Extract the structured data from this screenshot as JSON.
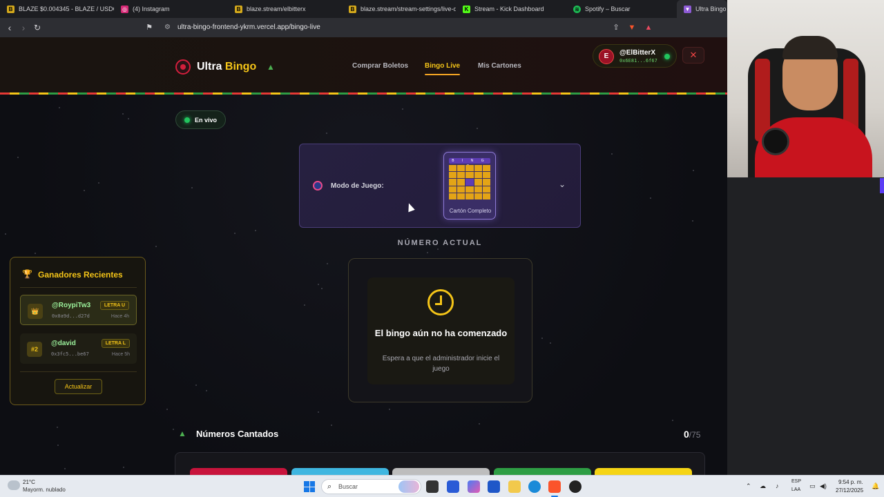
{
  "browser": {
    "tabs": [
      {
        "title": "BLAZE $0.004345 - BLAZE / USDC on",
        "icon": "blaze-icon",
        "color": "#d4a91c"
      },
      {
        "title": "(4) Instagram",
        "icon": "instagram-icon",
        "color": "#d62976"
      },
      {
        "title": "blaze.stream/elbitterx",
        "icon": "blaze-icon",
        "color": "#d4a91c"
      },
      {
        "title": "blaze.stream/stream-settings/live-da",
        "icon": "blaze-icon",
        "color": "#d4a91c"
      },
      {
        "title": "Stream - Kick Dashboard",
        "icon": "kick-icon",
        "color": "#53fc18"
      },
      {
        "title": "Spotify – Buscar",
        "icon": "spotify-icon",
        "color": "#1db954"
      },
      {
        "title": "Ultra Bingo - U",
        "icon": "ultra-bingo-icon",
        "color": "#8e5bd6"
      }
    ],
    "url": "ultra-bingo-frontend-ykrm.vercel.app/bingo-live"
  },
  "header": {
    "logo_part1": "Ultra",
    "logo_part2": "Bingo",
    "nav": [
      "Comprar Boletos",
      "Bingo Live",
      "Mis Cartones"
    ],
    "active_nav": "Bingo Live",
    "user": {
      "initial": "E",
      "name": "@ElBitterX",
      "address": "0x6E81...6f67"
    },
    "logout_symbol": "✕"
  },
  "status": {
    "label": "En vivo"
  },
  "mode": {
    "label": "Modo de Juego:",
    "card_header": "B I N G O",
    "card_label": "Cartón Completo"
  },
  "current_number": {
    "section_label": "NÚMERO ACTUAL",
    "title": "El bingo aún no ha comenzado",
    "subtitle": "Espera a que el administrador inicie el juego"
  },
  "winners": {
    "title": "Ganadores Recientes",
    "items": [
      {
        "badge": "👑",
        "name": "@RoypiTw3",
        "address": "0x0a9d...d27d",
        "tag": "LETRA U",
        "time": "Hace 4h"
      },
      {
        "badge": "#2",
        "name": "@david",
        "address": "0x3fc5...be67",
        "tag": "LETRA L",
        "time": "Hace 5h"
      }
    ],
    "refresh_label": "Actualizar"
  },
  "called_numbers": {
    "title": "Números Cantados",
    "count": "0",
    "total": "/75",
    "column_colors": [
      "#c8143c",
      "#3fb6e0",
      "#bdbdbd",
      "#2e9d44",
      "#f5d415"
    ]
  },
  "taskbar": {
    "temperature": "21°C",
    "weather": "Mayorm. nublado",
    "search_placeholder": "Buscar",
    "lang_top": "ESP",
    "lang_bottom": "LAA",
    "time": "9:54 p. m.",
    "date": "27/12/2025"
  }
}
